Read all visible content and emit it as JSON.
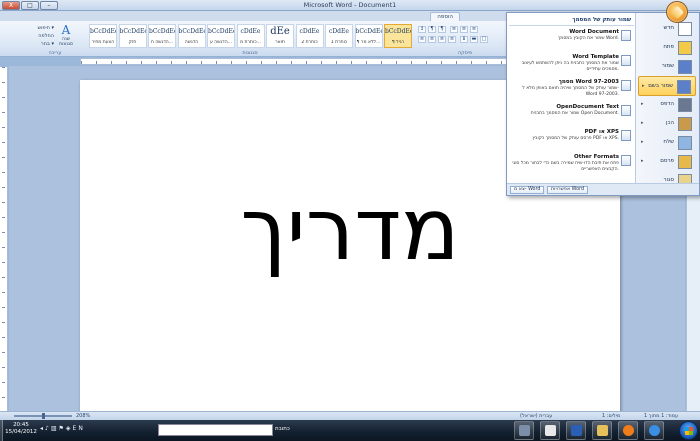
{
  "window": {
    "title": "Microsoft Word - Document1",
    "min": "–",
    "max": "□",
    "close": "X"
  },
  "ribbon": {
    "active_tab": "הוספה",
    "groups": {
      "styles": "סגנונות",
      "paragraph": "פיסקה",
      "editing": "עריכה"
    },
    "styles": [
      {
        "sample": "bCcDdEe",
        "name": "¶ רגיל",
        "active": true
      },
      {
        "sample": "bCcDdEe",
        "name": "¶ ללא מר..."
      },
      {
        "sample": "cDdEe",
        "name": "כותרת 1"
      },
      {
        "sample": "cDdEe",
        "name": "כותרת 2"
      },
      {
        "sample": "dEe",
        "name": "תואר"
      },
      {
        "sample": "cDdEe",
        "name": "כותרת מ..."
      },
      {
        "sample": "bCcDdEe",
        "name": "הדגשה ע..."
      },
      {
        "sample": "bCcDdEe",
        "name": "הדגשה"
      },
      {
        "sample": "bCcDdEe",
        "name": "הדגשה ח..."
      },
      {
        "sample": "bCcDdEe",
        "name": "חזק"
      },
      {
        "sample": "bCcDdEe",
        "name": "הצעת מחיר"
      }
    ],
    "editing": {
      "find": "חיפוש ▾",
      "replace": "החלפה",
      "select": "בחר ▾"
    },
    "change_styles": {
      "glyph": "A",
      "label_line1": "שנה",
      "label_line2": "סגנונות"
    }
  },
  "document": {
    "text": "מדריך"
  },
  "office_menu": {
    "commands": [
      {
        "label": "חדש"
      },
      {
        "label": "פתח"
      },
      {
        "label": "שמור"
      },
      {
        "label": "שמור בשם",
        "highlight": true,
        "arrow": "▸"
      },
      {
        "label": "הדפס",
        "arrow": "▸"
      },
      {
        "label": "הכן",
        "arrow": "▸"
      },
      {
        "label": "שלח",
        "arrow": "▸"
      },
      {
        "label": "פרסם",
        "arrow": "▸"
      },
      {
        "label": "סגור"
      }
    ],
    "submenu_header": "שמור עותק של המסמך",
    "submenu": [
      {
        "title": "Word Document",
        "desc": "שמור את הקובץ במסמך Word."
      },
      {
        "title": "Word Template",
        "desc": "שמור את המסמך כתבנית בה ניתן להשתמש לעיצוב מסמכים עתידיים."
      },
      {
        "title": "מסמך Word 97-2003",
        "desc": "שמור עותק של המסמך שיהיה תואם באופן מלא ל- Word 97-2003."
      },
      {
        "title": "OpenDocument Text",
        "desc": "שמור את המסמך בתבנית Open Document."
      },
      {
        "title": "PDF או XPS",
        "desc": "פרסם עותק של המסמך כקובץ PDF או XPS."
      },
      {
        "title": "Other Formats",
        "desc": "פתח את תיבת הדו-שיח שמירה בשם כדי לבחור מכל סוגי הקבצים האפשריים."
      }
    ],
    "footer": {
      "options": "אפשרויות Word",
      "exit": "צא מ- Word"
    }
  },
  "statusbar": {
    "page": "עמוד: 1 מתוך 1",
    "words": "מילים: 1",
    "language": "עברית (ישראל)",
    "zoom": "208%"
  },
  "taskbar": {
    "time": "20:45",
    "date": "15/04/2012",
    "address_label": "כתובת",
    "address_value": ""
  },
  "colors": {
    "accent": "#2d6fc1",
    "highlight": "#ffd15a"
  }
}
